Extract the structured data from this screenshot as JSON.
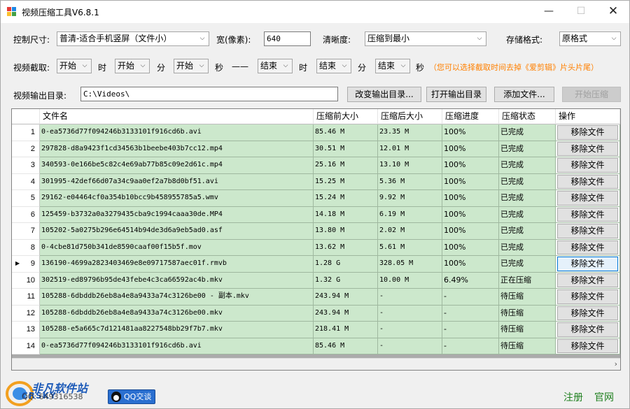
{
  "window": {
    "title": "视频压缩工具V6.8.1",
    "min_glyph": "—",
    "max_glyph": "☐",
    "close_glyph": "✕"
  },
  "controls": {
    "size_label": "控制尺寸:",
    "size_value": "普清-适合手机竖屏（文件小）",
    "width_label": "宽(像素):",
    "width_value": "640",
    "clarity_label": "清晰度:",
    "clarity_value": "压缩到最小",
    "format_label": "存储格式:",
    "format_value": "原格式",
    "clip_label": "视频截取:",
    "start_hour": "开始",
    "start_min": "开始",
    "start_sec": "开始",
    "unit_hour": "时",
    "unit_min": "分",
    "unit_sec": "秒",
    "dash": "——",
    "end_hour": "结束",
    "end_min": "结束",
    "end_sec": "结束",
    "unit_hour2": "时",
    "unit_min2": "分",
    "unit_sec2": "秒",
    "tip": "（您可以选择截取时间去掉《爱剪辑》片头片尾）",
    "output_label": "视频输出目录:",
    "output_path": "C:\\Videos\\",
    "change_dir_button": "改变输出目录...",
    "open_dir_button": "打开输出目录",
    "add_file_button": "添加文件...",
    "start_button": "开始压缩",
    "dropdown_arrow": "⌵"
  },
  "table": {
    "columns": [
      "文件名",
      "压缩前大小",
      "压缩后大小",
      "压缩进度",
      "压缩状态",
      "操作"
    ],
    "remove_label": "移除文件",
    "current_row_marker": "▶",
    "rows": [
      {
        "n": "1",
        "name": "0-ea5736d77f094246b3133101f916cd6b.avi",
        "before": "85.46 M",
        "after": "23.35 M",
        "progress": "100%",
        "status": "已完成"
      },
      {
        "n": "2",
        "name": "297828-d8a9423f1cd34563b1beebe403b7cc12.mp4",
        "before": "30.51 M",
        "after": "12.01 M",
        "progress": "100%",
        "status": "已完成"
      },
      {
        "n": "3",
        "name": "340593-0e166be5c82c4e69ab77b85c09e2d61c.mp4",
        "before": "25.16 M",
        "after": "13.10 M",
        "progress": "100%",
        "status": "已完成"
      },
      {
        "n": "4",
        "name": "301995-42def66d07a34c9aa0ef2a7b8d0bf51.avi",
        "before": "15.25 M",
        "after": "5.36 M",
        "progress": "100%",
        "status": "已完成"
      },
      {
        "n": "5",
        "name": "29162-e04464cf0a354b10bcc9b458955785a5.wmv",
        "before": "15.24 M",
        "after": "9.92 M",
        "progress": "100%",
        "status": "已完成"
      },
      {
        "n": "6",
        "name": "125459-b3732a0a3279435cba9c1994caaa30de.MP4",
        "before": "14.18 M",
        "after": "6.19 M",
        "progress": "100%",
        "status": "已完成"
      },
      {
        "n": "7",
        "name": "105202-5a0275b296e64514b94de3d6a9eb5ad0.asf",
        "before": "13.80 M",
        "after": "2.02 M",
        "progress": "100%",
        "status": "已完成"
      },
      {
        "n": "8",
        "name": "0-4cbe81d750b341de8590caaf00f15b5f.mov",
        "before": "13.62 M",
        "after": "5.61 M",
        "progress": "100%",
        "status": "已完成"
      },
      {
        "n": "9",
        "name": "136190-4699a2823403469e8e09717587aec01f.rmvb",
        "before": "1.28 G",
        "after": "328.05 M",
        "progress": "100%",
        "status": "已完成"
      },
      {
        "n": "10",
        "name": "302519-ed89796b95de43febe4c3ca66592ac4b.mkv",
        "before": "1.32 G",
        "after": "10.00 M",
        "progress": "6.49%",
        "status": "正在压缩"
      },
      {
        "n": "11",
        "name": "105288-6dbddb26eb8a4e8a9433a74c3126be00 - 副本.mkv",
        "before": "243.94 M",
        "after": "-",
        "progress": "-",
        "status": "待压缩"
      },
      {
        "n": "12",
        "name": "105288-6dbddb26eb8a4e8a9433a74c3126be00.mkv",
        "before": "243.94 M",
        "after": "-",
        "progress": "-",
        "status": "待压缩"
      },
      {
        "n": "13",
        "name": "105288-e5a665c7d121481aa8227548bb29f7b7.mkv",
        "before": "218.41 M",
        "after": "-",
        "progress": "-",
        "status": "待压缩"
      },
      {
        "n": "14",
        "name": "0-ea5736d77f094246b3133101f916cd6b.avi",
        "before": "85.46 M",
        "after": "-",
        "progress": "-",
        "status": "待压缩"
      }
    ]
  },
  "footer": {
    "logo_text": "非凡软件站",
    "logo_sub": "CRSKY",
    "qq_number": "QQ: 649316538",
    "qq_button": "QQ交谈",
    "register_link": "注册",
    "website_link": "官网",
    "scroll_right": "›"
  },
  "colors": {
    "row_fill": "#cce8cc",
    "tip_text": "#ff8000",
    "link_text": "#208020"
  }
}
